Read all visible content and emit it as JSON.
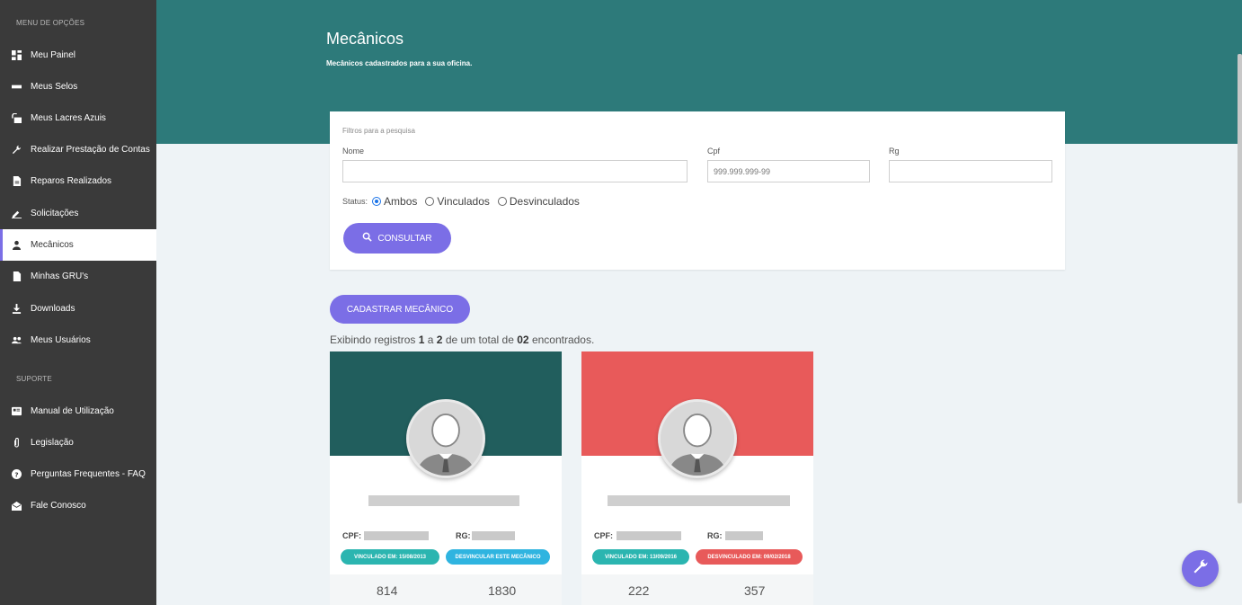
{
  "sidebar": {
    "section_menu": "MENU DE OPÇÕES",
    "section_support": "SUPORTE",
    "items": [
      {
        "label": "Meu Painel",
        "icon": "dashboard-icon"
      },
      {
        "label": "Meus Selos",
        "icon": "seal-icon"
      },
      {
        "label": "Meus Lacres Azuis",
        "icon": "lock-icon"
      },
      {
        "label": "Realizar Prestação de Contas",
        "icon": "wrench-icon"
      },
      {
        "label": "Reparos Realizados",
        "icon": "document-icon"
      },
      {
        "label": "Solicitações",
        "icon": "pencil-icon"
      },
      {
        "label": "Mecânicos",
        "icon": "person-icon"
      },
      {
        "label": "Minhas GRU's",
        "icon": "file-icon"
      },
      {
        "label": "Downloads",
        "icon": "download-icon"
      },
      {
        "label": "Meus Usuários",
        "icon": "users-icon"
      }
    ],
    "support_items": [
      {
        "label": "Manual de Utilização",
        "icon": "manual-icon"
      },
      {
        "label": "Legislação",
        "icon": "paperclip-icon"
      },
      {
        "label": "Perguntas Frequentes - FAQ",
        "icon": "help-icon"
      },
      {
        "label": "Fale Conosco",
        "icon": "mail-icon"
      }
    ]
  },
  "header": {
    "title": "Mecânicos",
    "subtitle": "Mecânicos cadastrados para a sua oficina."
  },
  "filters": {
    "legend": "Filtros para a pesquisa",
    "nome_label": "Nome",
    "nome_value": "",
    "cpf_label": "Cpf",
    "cpf_placeholder": "999.999.999-99",
    "rg_label": "Rg",
    "rg_value": "",
    "status_label": "Status:",
    "status_options": [
      "Ambos",
      "Vinculados",
      "Desvinculados"
    ],
    "status_selected": "Ambos",
    "consult_label": "CONSULTAR"
  },
  "actions": {
    "cadastrar_label": "CADASTRAR MECÂNICO"
  },
  "records": {
    "prefix": "Exibindo registros",
    "from": "1",
    "sep": "a",
    "to": "2",
    "mid": "de um total de",
    "total": "02",
    "suffix": "encontrados."
  },
  "mechanics": [
    {
      "banner_color": "#215e5d",
      "cpf_label": "CPF:",
      "rg_label": "RG:",
      "badge1": "VINCULADO EM: 15/08/2013",
      "badge1_color": "#2bb5b0",
      "badge2": "DESVINCULAR ESTE MECÂNICO",
      "badge2_color": "#2fb4e0",
      "stat1": "814",
      "stat2": "1830"
    },
    {
      "banner_color": "#e85a5a",
      "cpf_label": "CPF:",
      "rg_label": "RG:",
      "badge1": "VINCULADO EM: 13/09/2016",
      "badge1_color": "#2bb5b0",
      "badge2": "DESVINCULADO EM: 09/02/2018",
      "badge2_color": "#e85a5a",
      "stat1": "222",
      "stat2": "357"
    }
  ],
  "colors": {
    "header": "#2d7a7a",
    "accent": "#7b6ee6",
    "sidebar": "#3a3a3a"
  }
}
